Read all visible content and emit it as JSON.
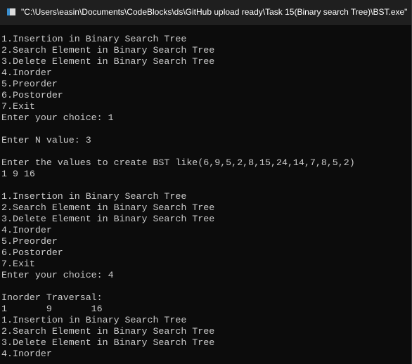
{
  "window": {
    "title": "\"C:\\Users\\easin\\Documents\\CodeBlocks\\ds\\GitHub upload ready\\Task 15(Binary search Tree)\\BST.exe\""
  },
  "console": {
    "lines": [
      "1.Insertion in Binary Search Tree",
      "2.Search Element in Binary Search Tree",
      "3.Delete Element in Binary Search Tree",
      "4.Inorder",
      "5.Preorder",
      "6.Postorder",
      "7.Exit",
      "Enter your choice: 1",
      "",
      "Enter N value: 3",
      "",
      "Enter the values to create BST like(6,9,5,2,8,15,24,14,7,8,5,2)",
      "1 9 16",
      "",
      "1.Insertion in Binary Search Tree",
      "2.Search Element in Binary Search Tree",
      "3.Delete Element in Binary Search Tree",
      "4.Inorder",
      "5.Preorder",
      "6.Postorder",
      "7.Exit",
      "Enter your choice: 4",
      "",
      "Inorder Traversal:",
      "1\t9\t16",
      "1.Insertion in Binary Search Tree",
      "2.Search Element in Binary Search Tree",
      "3.Delete Element in Binary Search Tree",
      "4.Inorder"
    ]
  }
}
